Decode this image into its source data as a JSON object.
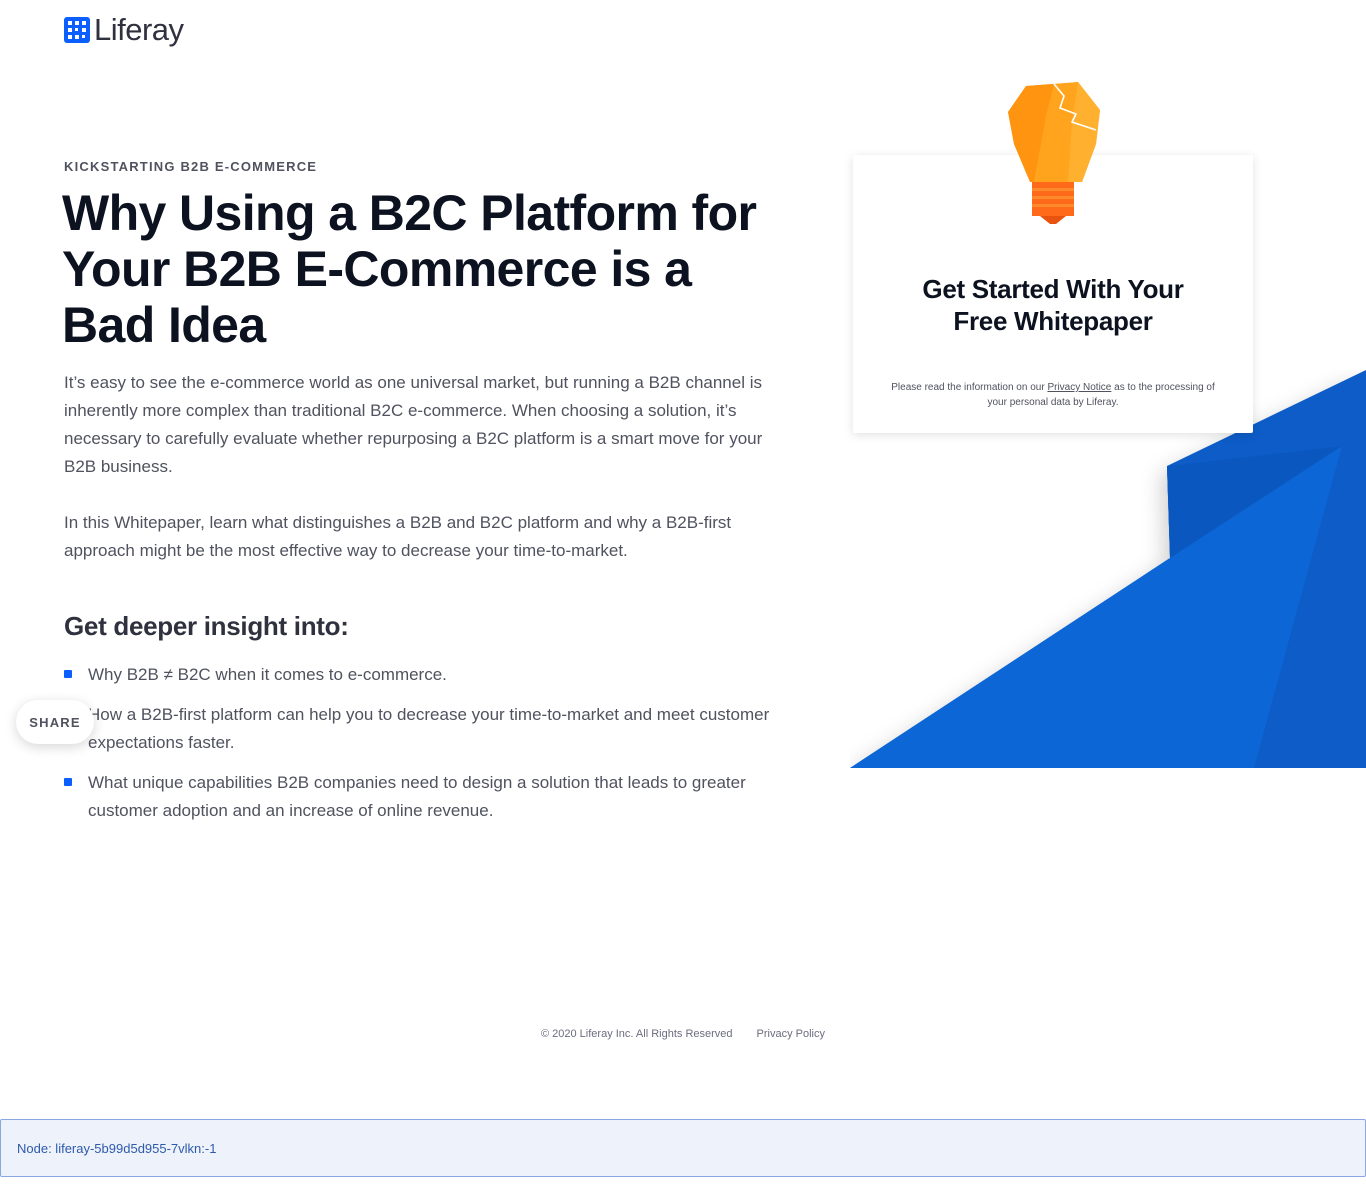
{
  "header": {
    "logo_text": "Liferay",
    "logo_icon": "liferay-grid-icon"
  },
  "article": {
    "eyebrow": "KICKSTARTING B2B E-COMMERCE",
    "title": "Why Using a B2C Platform for Your B2B E-Commerce is a Bad Idea",
    "paragraph_1": "It’s easy to see the e-commerce world as one universal market, but running a B2B channel is inherently more complex than traditional B2C e-commerce. When choosing a solution, it’s necessary to carefully evaluate whether repurposing a B2C platform is a smart move for your B2B business.",
    "paragraph_2": "In this Whitepaper, learn what distinguishes a B2B and B2C platform and why a B2B-first approach might be the most effective way to decrease your time-to-market.",
    "insight_heading": "Get deeper insight into:",
    "bullets": [
      "Why B2B ≠ B2C when it comes to e-commerce.",
      "How a B2B-first platform can help you to decrease your time-to-market and meet customer expectations faster.",
      "What unique capabilities B2B companies need to design a solution that leads to greater customer adoption and an increase of online revenue."
    ]
  },
  "share": {
    "label": "SHARE"
  },
  "form_card": {
    "icon": "lightbulb-icon",
    "title": "Get Started With Your Free Whitepaper",
    "notice_prefix": "Please read the information on our ",
    "notice_link": "Privacy Notice",
    "notice_suffix": " as to the processing of your personal data by Liferay."
  },
  "footer": {
    "copyright": "© 2020 Liferay Inc. All Rights Reserved",
    "privacy_link": "Privacy Policy"
  },
  "debug": {
    "node_text": "Node: liferay-5b99d5d955-7vlkn:-1"
  },
  "colors": {
    "brand_blue": "#0b5fff",
    "shape_blue": "#0b63ce",
    "bulb_orange": "#ff9f1a",
    "bulb_base": "#ff5f1f"
  }
}
